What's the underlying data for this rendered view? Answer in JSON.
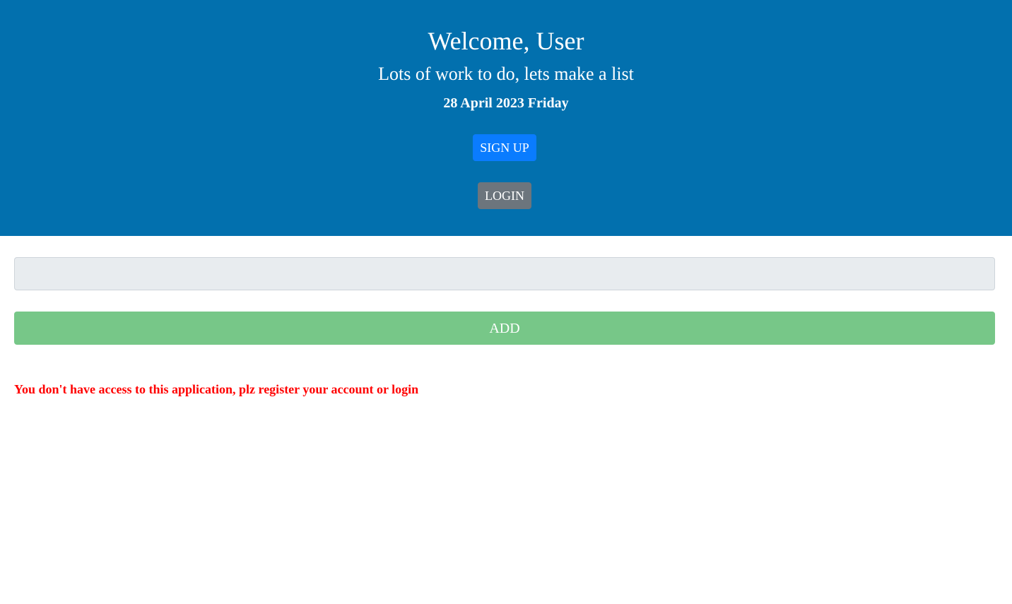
{
  "header": {
    "title": "Welcome, User",
    "subtitle": "Lots of work to do, lets make a list",
    "date": "28 April 2023 Friday",
    "signup_label": "SIGN UP",
    "login_label": "LOGIN"
  },
  "form": {
    "task_value": "",
    "task_placeholder": "",
    "add_label": "ADD"
  },
  "message": {
    "error": "You don't have access to this application, plz register your account or login"
  },
  "colors": {
    "header_bg": "#0270ae",
    "signup_bg": "#0a7cff",
    "login_bg": "#6c757d",
    "add_bg": "#77c788",
    "error_text": "#ff0000"
  }
}
